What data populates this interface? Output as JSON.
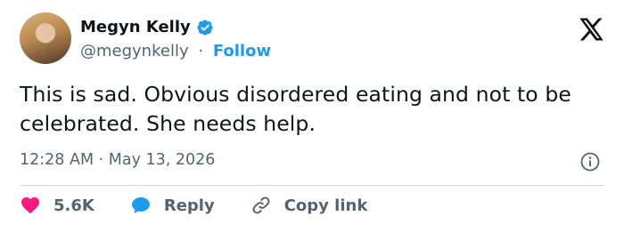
{
  "author": {
    "name": "Megyn Kelly",
    "handle": "@megynkelly",
    "separator": "·",
    "follow_label": "Follow",
    "verified": true
  },
  "tweet": {
    "text": "This is sad. Obvious disordered eating and not to be celebrated. She needs help.",
    "time": "12:28 AM · May 13, 2026"
  },
  "actions": {
    "likes": "5.6K",
    "reply_label": "Reply",
    "copy_link_label": "Copy link"
  },
  "icons": [
    "verified-badge-icon",
    "x-logo-icon",
    "info-icon",
    "heart-icon",
    "reply-bubble-icon",
    "link-icon"
  ],
  "colors": {
    "accent": "#1d9bf0",
    "like": "#f91880",
    "text_primary": "#0f1419",
    "text_secondary": "#536471",
    "divider": "#cfd9de"
  }
}
